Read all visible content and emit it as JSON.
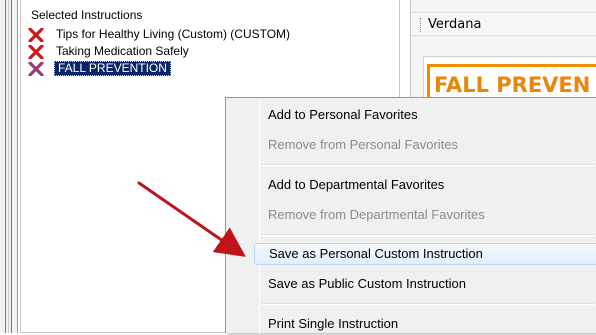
{
  "left_panel": {
    "header": "Selected Instructions",
    "items": [
      {
        "label": "Tips for Healthy Living (Custom) (CUSTOM)",
        "icon": "red-x-icon",
        "selected": false
      },
      {
        "label": "Taking Medication Safely",
        "icon": "red-x-icon",
        "selected": false
      },
      {
        "label": "FALL PREVENTION",
        "icon": "red-x-icon",
        "selected": true
      }
    ]
  },
  "right_panel": {
    "font_name": "Verdana",
    "document_title": "FALL PREVEN"
  },
  "context_menu": {
    "items": [
      {
        "label": "Add to Personal Favorites",
        "enabled": true
      },
      {
        "label": "Remove from Personal Favorites",
        "enabled": false
      },
      {
        "label": "Add to Departmental Favorites",
        "enabled": true
      },
      {
        "label": "Remove from Departmental Favorites",
        "enabled": false
      },
      {
        "label": "Save as Personal Custom Instruction",
        "enabled": true,
        "highlighted": true
      },
      {
        "label": "Save as Public Custom Instruction",
        "enabled": true
      },
      {
        "label": "Print Single Instruction",
        "enabled": true
      }
    ]
  },
  "colors": {
    "selection_background": "#0a246a",
    "doc_title_orange": "#e8870a",
    "arrow_red": "#c0141a",
    "menu_highlight_border": "#b8d6f5"
  }
}
